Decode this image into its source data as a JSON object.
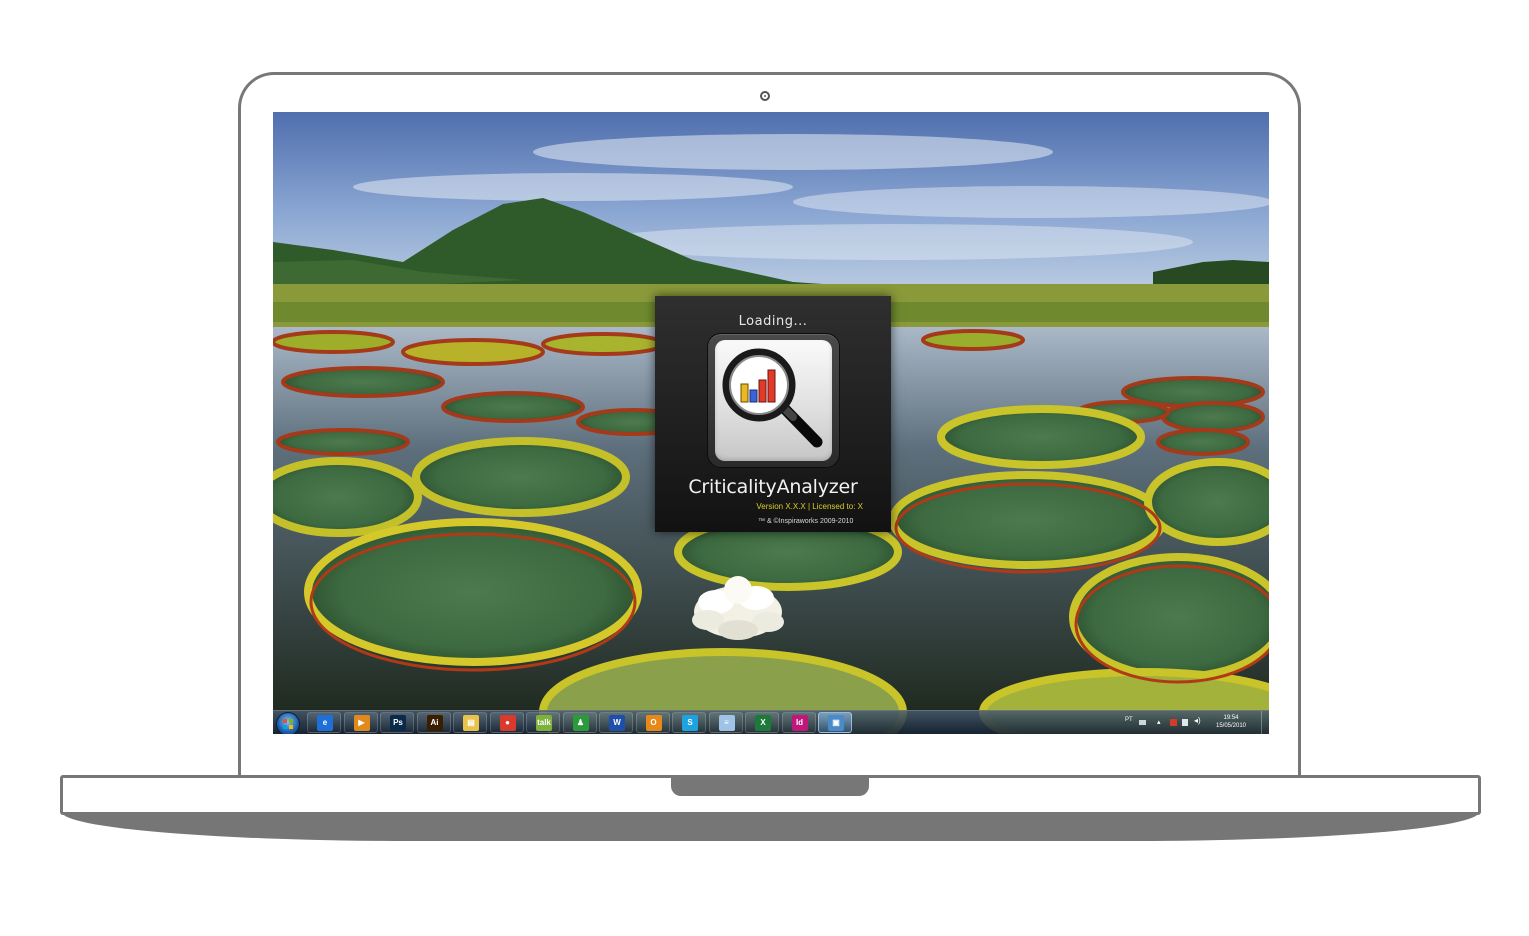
{
  "splash": {
    "loading_text": "Loading...",
    "app_name": "CriticalityAnalyzer",
    "version_line": "Version X.X.X | Licensed to: X",
    "copyright": "™ & ©Inspiraworks 2009-2010",
    "icon": "magnifier-bar-chart-icon"
  },
  "taskbar": {
    "start_icon": "windows-start-icon",
    "apps": [
      {
        "name": "internet-explorer",
        "label": "e",
        "color": "#1e6fd6"
      },
      {
        "name": "media-player",
        "label": "▶",
        "color": "#e08a1e"
      },
      {
        "name": "photoshop",
        "label": "Ps",
        "color": "#0a2a4a"
      },
      {
        "name": "illustrator",
        "label": "Ai",
        "color": "#3a1e00"
      },
      {
        "name": "explorer",
        "label": "▤",
        "color": "#e8c24a"
      },
      {
        "name": "chrome",
        "label": "●",
        "color": "#d93a2b"
      },
      {
        "name": "google-talk",
        "label": "talk",
        "color": "#7fb23a"
      },
      {
        "name": "messenger",
        "label": "♟",
        "color": "#2a9a3a"
      },
      {
        "name": "word",
        "label": "W",
        "color": "#1f4fa8"
      },
      {
        "name": "outlook",
        "label": "O",
        "color": "#e58a1a"
      },
      {
        "name": "skype",
        "label": "S",
        "color": "#1fa3e0"
      },
      {
        "name": "notepad",
        "label": "≡",
        "color": "#9fc3e6"
      },
      {
        "name": "excel",
        "label": "X",
        "color": "#1e7a3a"
      },
      {
        "name": "indesign",
        "label": "Id",
        "color": "#c0177a"
      },
      {
        "name": "remote-desktop",
        "label": "▣",
        "color": "#4a8ac8"
      }
    ],
    "active_app": "remote-desktop",
    "language": "PT",
    "time": "19:54",
    "date": "15/05/2010",
    "tray_icons": [
      "keyboard-icon",
      "show-hidden-icons-icon",
      "flag-icon",
      "network-icon",
      "volume-icon"
    ]
  },
  "colors": {
    "splash_bg": "#1f1f1f",
    "version_text": "#d8cf2a",
    "laptop_frame": "#777777"
  }
}
